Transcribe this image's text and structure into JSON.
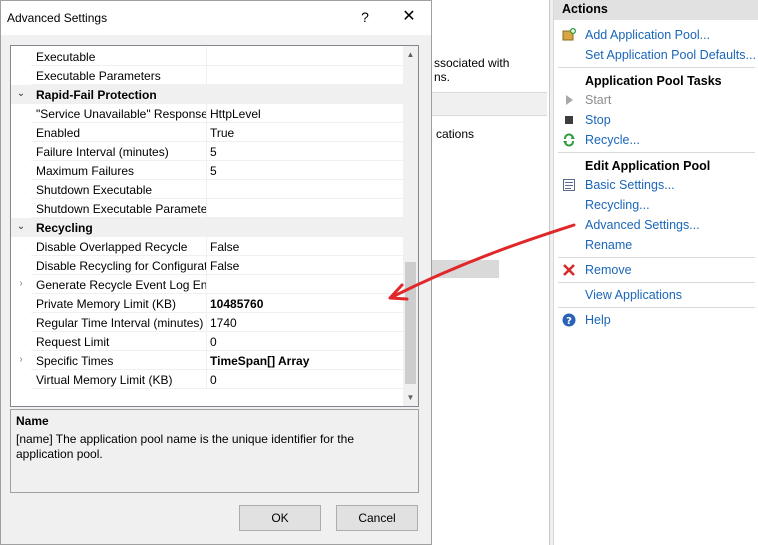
{
  "background": {
    "description_lines": [
      "ssociated with",
      "ns."
    ],
    "column_text": "cations"
  },
  "actions": {
    "title": "Actions",
    "items": [
      {
        "icon": "add-pool-icon",
        "label": "Add Application Pool...",
        "enabled": true
      },
      {
        "icon": "none",
        "label": "Set Application Pool Defaults...",
        "enabled": true
      }
    ],
    "tasks_heading": "Application Pool Tasks",
    "tasks": [
      {
        "icon": "start-icon",
        "label": "Start",
        "enabled": false
      },
      {
        "icon": "stop-icon",
        "label": "Stop",
        "enabled": true
      },
      {
        "icon": "recycle-icon",
        "label": "Recycle...",
        "enabled": true
      }
    ],
    "edit_heading": "Edit Application Pool",
    "edit": [
      {
        "icon": "basic-settings-icon",
        "label": "Basic Settings...",
        "enabled": true
      },
      {
        "icon": "none",
        "label": "Recycling...",
        "enabled": true
      },
      {
        "icon": "none",
        "label": "Advanced Settings...",
        "enabled": true
      },
      {
        "icon": "none",
        "label": "Rename",
        "enabled": true
      }
    ],
    "remove": {
      "icon": "remove-icon",
      "label": "Remove"
    },
    "view_apps": {
      "label": "View Applications"
    },
    "help": {
      "icon": "help-icon",
      "label": "Help"
    }
  },
  "dialog": {
    "title": "Advanced Settings",
    "help_glyph": "?",
    "close_glyph": "✕",
    "rows": [
      {
        "type": "prop",
        "name": "Executable",
        "value": "",
        "bold": false,
        "expander": ""
      },
      {
        "type": "prop",
        "name": "Executable Parameters",
        "value": "",
        "bold": false,
        "expander": ""
      },
      {
        "type": "cat",
        "name": "Rapid-Fail Protection",
        "expander": "⌄"
      },
      {
        "type": "prop",
        "name": "\"Service Unavailable\" Response T",
        "value": "HttpLevel",
        "bold": false,
        "expander": ""
      },
      {
        "type": "prop",
        "name": "Enabled",
        "value": "True",
        "bold": false,
        "expander": ""
      },
      {
        "type": "prop",
        "name": "Failure Interval (minutes)",
        "value": "5",
        "bold": false,
        "expander": ""
      },
      {
        "type": "prop",
        "name": "Maximum Failures",
        "value": "5",
        "bold": false,
        "expander": ""
      },
      {
        "type": "prop",
        "name": "Shutdown Executable",
        "value": "",
        "bold": false,
        "expander": ""
      },
      {
        "type": "prop",
        "name": "Shutdown Executable Parameter",
        "value": "",
        "bold": false,
        "expander": ""
      },
      {
        "type": "cat",
        "name": "Recycling",
        "expander": "⌄"
      },
      {
        "type": "prop",
        "name": "Disable Overlapped Recycle",
        "value": "False",
        "bold": false,
        "expander": ""
      },
      {
        "type": "prop",
        "name": "Disable Recycling for Configurat",
        "value": "False",
        "bold": false,
        "expander": ""
      },
      {
        "type": "prop",
        "name": "Generate Recycle Event Log Entr",
        "value": "",
        "bold": false,
        "expander": "›"
      },
      {
        "type": "prop",
        "name": "Private Memory Limit (KB)",
        "value": "10485760",
        "bold": true,
        "expander": ""
      },
      {
        "type": "prop",
        "name": "Regular Time Interval (minutes)",
        "value": "1740",
        "bold": false,
        "expander": ""
      },
      {
        "type": "prop",
        "name": "Request Limit",
        "value": "0",
        "bold": false,
        "expander": ""
      },
      {
        "type": "prop",
        "name": "Specific Times",
        "value": "TimeSpan[] Array",
        "bold": true,
        "expander": "›"
      },
      {
        "type": "prop",
        "name": "Virtual Memory Limit (KB)",
        "value": "0",
        "bold": false,
        "expander": ""
      }
    ],
    "description": {
      "title": "Name",
      "text": "[name] The application pool name is the unique identifier for the application pool."
    },
    "ok_label": "OK",
    "cancel_label": "Cancel"
  },
  "annotation_color": "#e0282a"
}
